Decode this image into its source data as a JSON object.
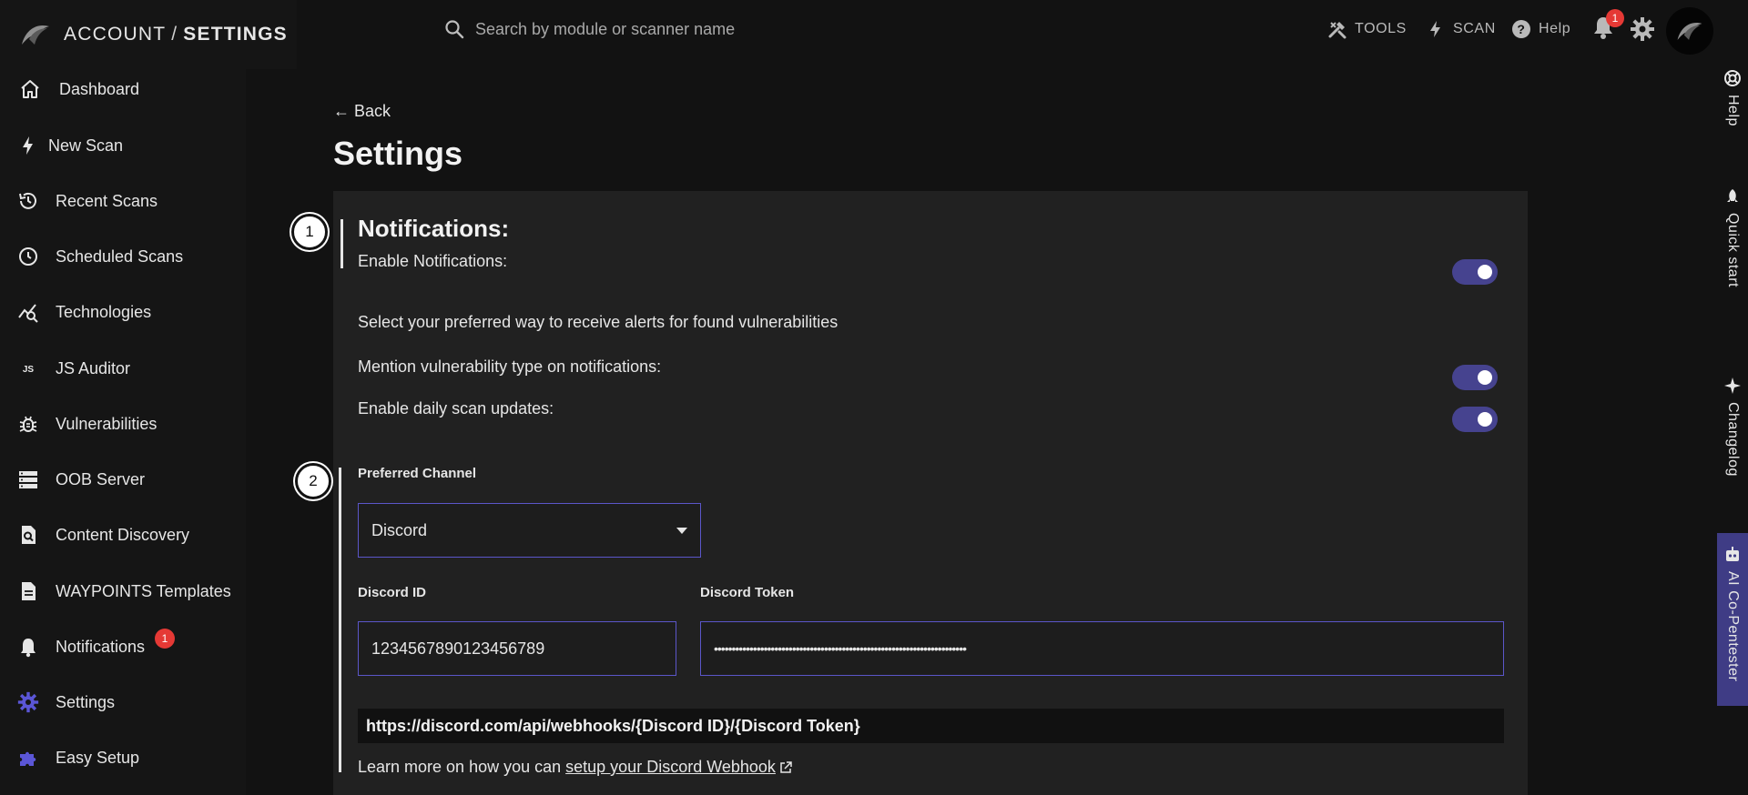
{
  "header": {
    "breadcrumb_account": "ACCOUNT",
    "breadcrumb_sep": "/",
    "breadcrumb_settings": "SETTINGS",
    "search_placeholder": "Search by module or scanner name",
    "tools_label": "TOOLS",
    "scan_label": "SCAN",
    "help_label": "Help",
    "notification_count": "1"
  },
  "sidebar": {
    "items": [
      {
        "label": "Dashboard",
        "icon": "home-icon"
      },
      {
        "label": "New Scan",
        "icon": "bolt-icon"
      },
      {
        "label": "Recent Scans",
        "icon": "history-icon"
      },
      {
        "label": "Scheduled Scans",
        "icon": "clock-icon"
      },
      {
        "label": "Technologies",
        "icon": "chart-search-icon"
      },
      {
        "label": "JS Auditor",
        "icon": "js-icon"
      },
      {
        "label": "Vulnerabilities",
        "icon": "bug-icon"
      },
      {
        "label": "OOB Server",
        "icon": "server-icon"
      },
      {
        "label": "Content Discovery",
        "icon": "file-search-icon"
      },
      {
        "label": "WAYPOINTS Templates",
        "icon": "document-icon"
      },
      {
        "label": "Notifications",
        "icon": "bell-icon",
        "badge": "1"
      },
      {
        "label": "Settings",
        "icon": "gear-icon",
        "active": true
      },
      {
        "label": "Easy Setup",
        "icon": "puzzle-icon"
      }
    ]
  },
  "rail": {
    "help": "Help",
    "quick_start": "Quick start",
    "changelog": "Changelog",
    "ai": "AI Co-Pentester"
  },
  "main": {
    "back": "← Back",
    "title": "Settings",
    "step1": "1",
    "step2": "2",
    "notifications_title": "Notifications:",
    "enable_notifications": "Enable Notifications:",
    "description": "Select your preferred way to receive alerts for found vulnerabilities",
    "mention_type": "Mention vulnerability type on notifications:",
    "daily_updates": "Enable daily scan updates:",
    "toggles": {
      "enable_notifications": true,
      "mention_type": true,
      "daily_updates": true
    },
    "accent_color": "#46438f",
    "preferred_channel_label": "Preferred Channel",
    "preferred_channel_value": "Discord",
    "discord_id_label": "Discord ID",
    "discord_id_value": "1234567890123456789",
    "discord_token_label": "Discord Token",
    "discord_token_value": "•••••••••••••••••••••••••••••••••••••••••••••••••••••••••••••••••••••••",
    "webhook_url": "https://discord.com/api/webhooks/{Discord ID}/{Discord Token}",
    "learn_more": "Learn more on how you can",
    "learn_link": "setup your Discord Webhook"
  }
}
